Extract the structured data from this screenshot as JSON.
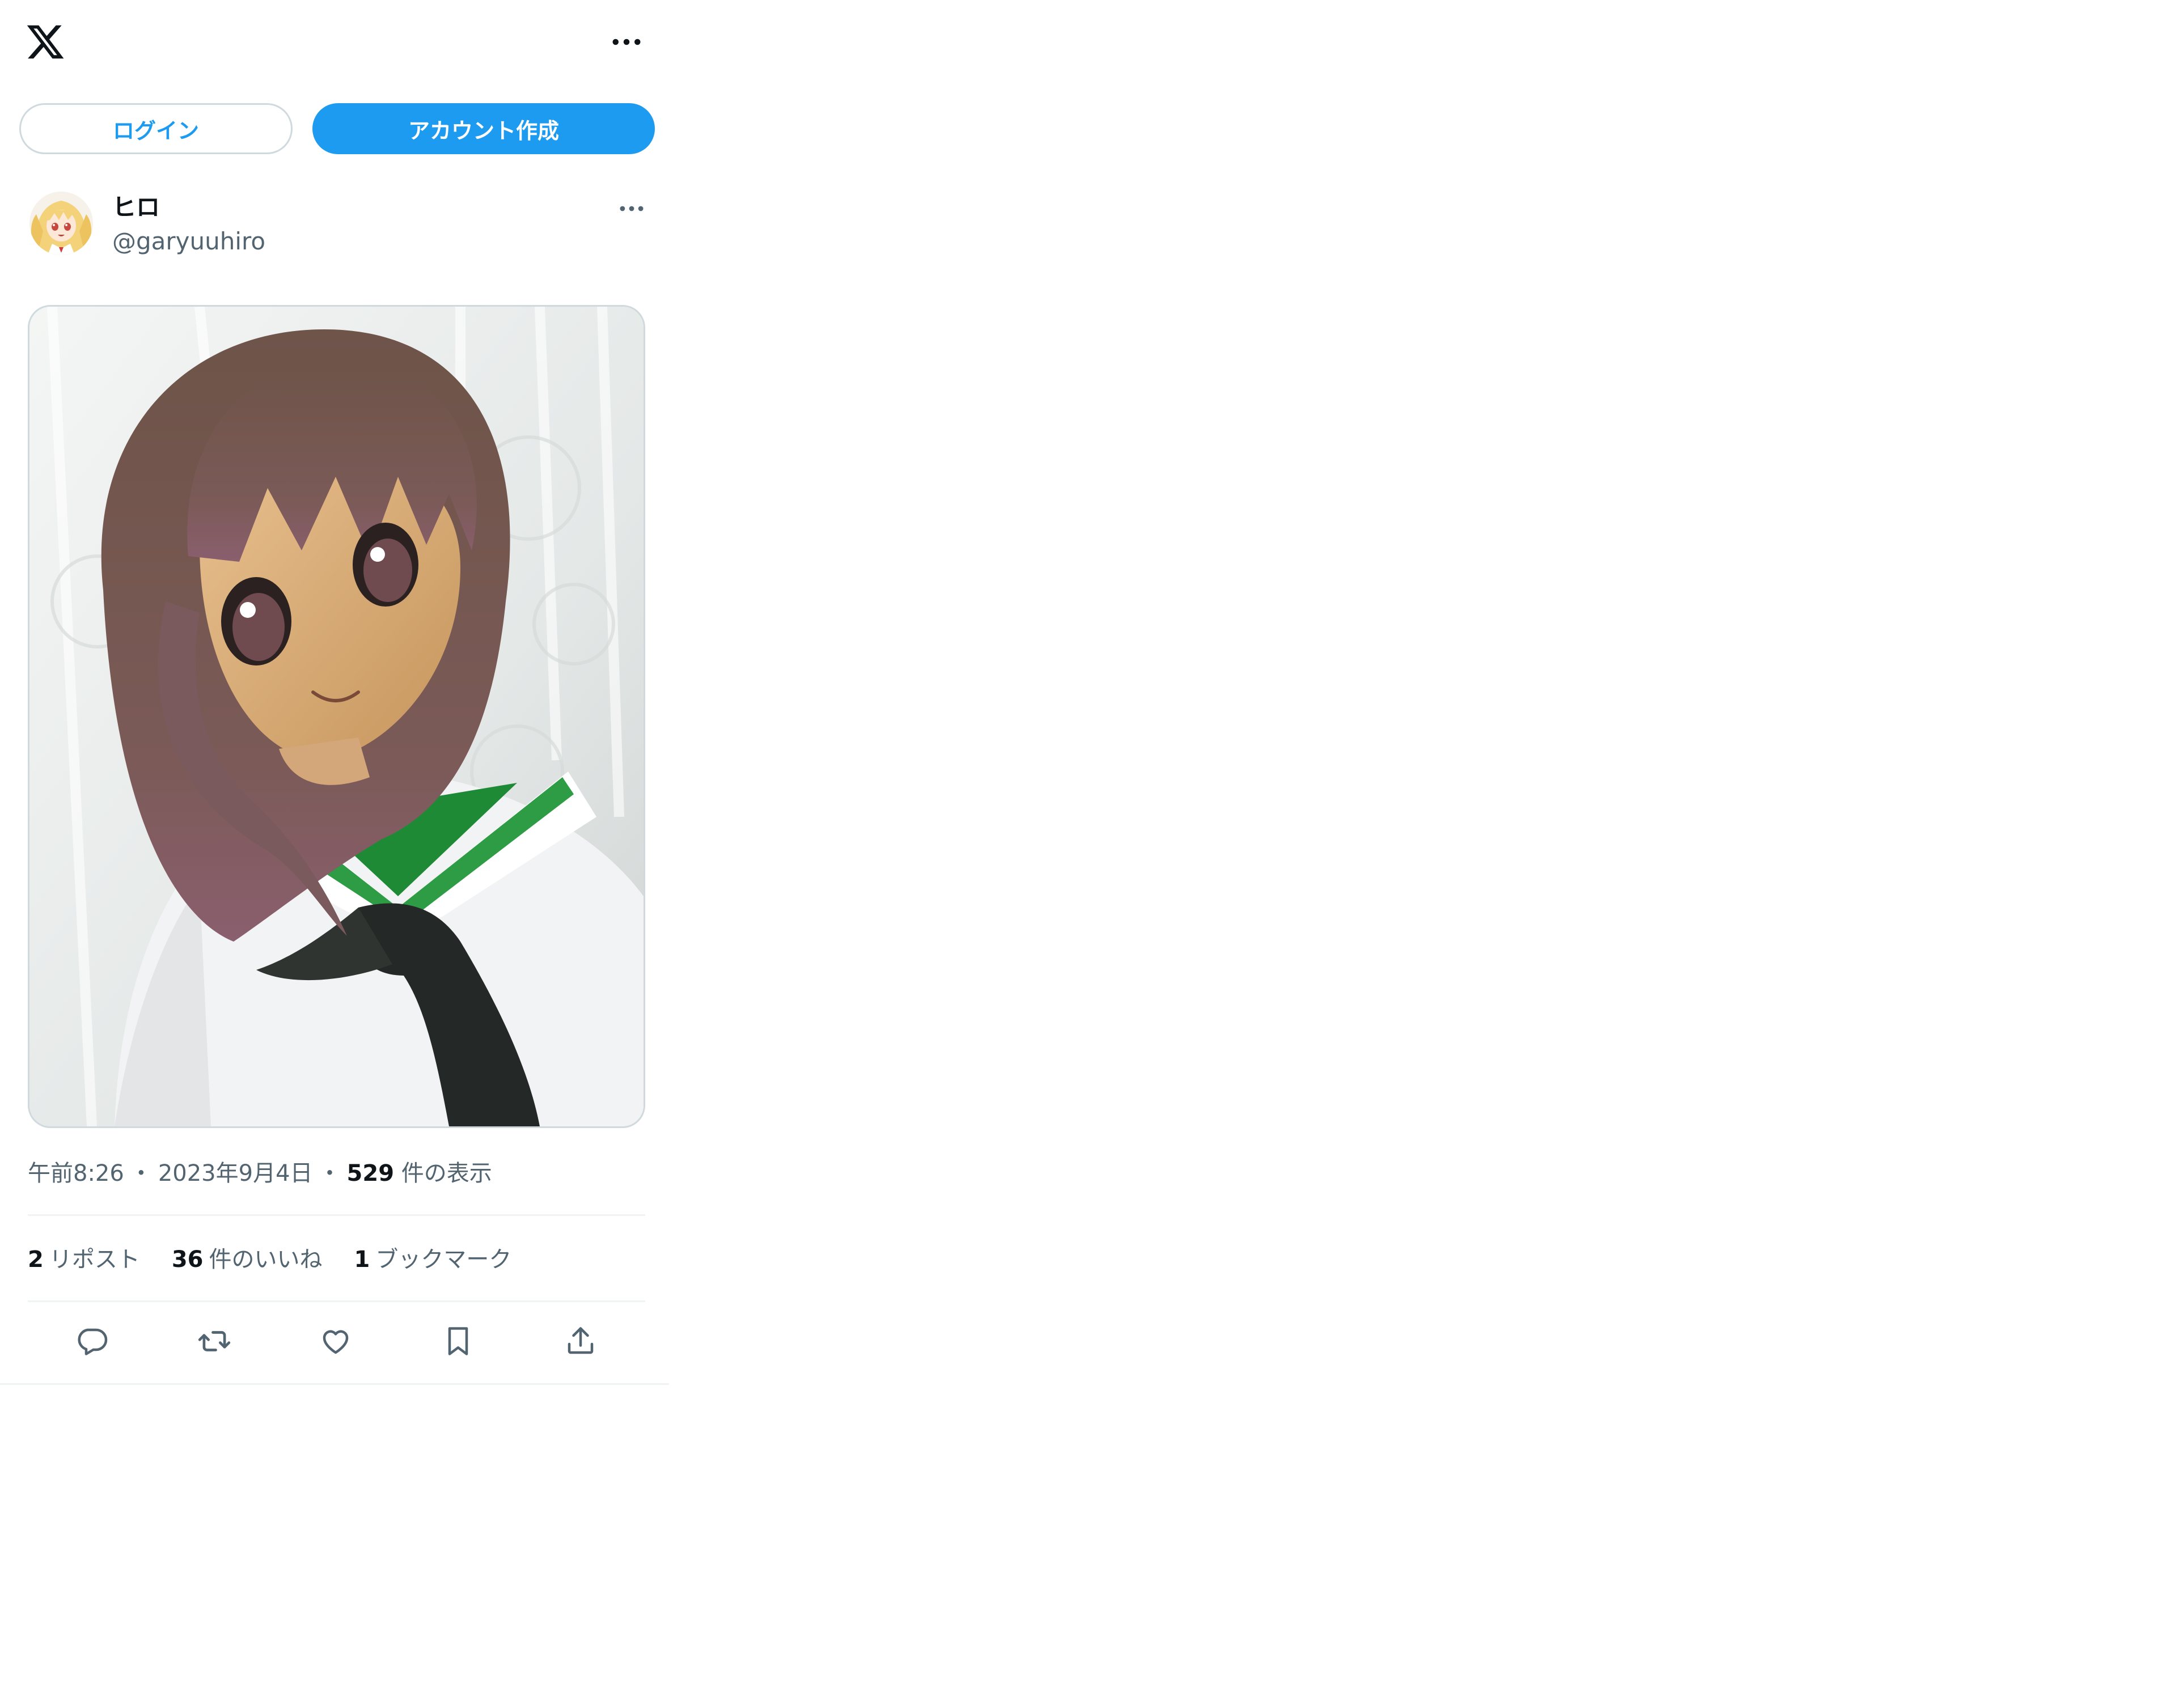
{
  "header": {
    "logo_icon": "x-logo-icon",
    "more_icon": "more-horizontal-icon"
  },
  "auth": {
    "login_label": "ログイン",
    "signup_label": "アカウント作成"
  },
  "tweet": {
    "author": {
      "display_name": "ヒロ",
      "handle": "@garyuuhiro",
      "avatar_icon": "avatar-anime-girl"
    },
    "media": {
      "image_subject": "photo-person-in-anime-mask-brown-wig-sailor-uniform"
    },
    "meta": {
      "time": "午前8:26",
      "separator": "・",
      "date": "2023年9月4日",
      "views_count": "529",
      "views_label": "件の表示"
    },
    "stats": {
      "reposts_count": "2",
      "reposts_label": "リポスト",
      "likes_count": "36",
      "likes_label": "件のいいね",
      "bookmarks_count": "1",
      "bookmarks_label": "ブックマーク"
    },
    "actions": [
      "reply-icon",
      "repost-icon",
      "like-icon",
      "bookmark-icon",
      "share-icon"
    ]
  },
  "colors": {
    "accent": "#1d9bf0",
    "text_primary": "#0f1419",
    "text_secondary": "#536471",
    "border": "#cfd9de",
    "divider": "#eff3f4"
  }
}
